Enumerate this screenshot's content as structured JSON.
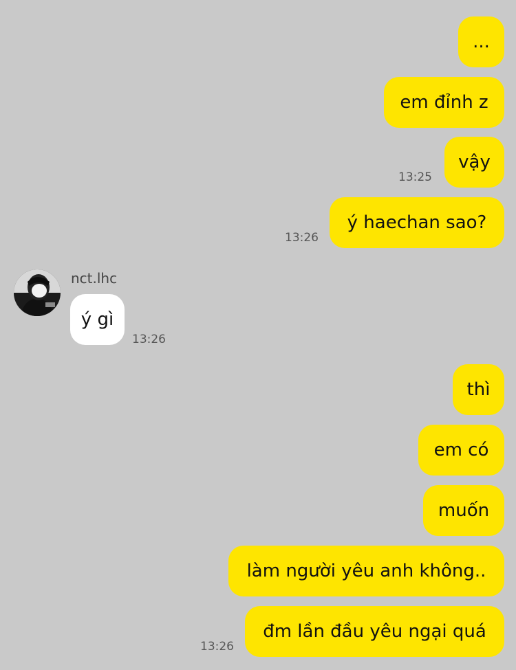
{
  "contact": {
    "name": "nct.lhc"
  },
  "messages": [
    {
      "direction": "outgoing",
      "text": "...",
      "time": ""
    },
    {
      "direction": "outgoing",
      "text": "em đỉnh z",
      "time": ""
    },
    {
      "direction": "outgoing",
      "text": "vậy",
      "time": "13:25"
    },
    {
      "direction": "outgoing",
      "text": "ý haechan sao?",
      "time": "13:26"
    },
    {
      "direction": "incoming",
      "text": "ý gì",
      "time": "13:26"
    },
    {
      "direction": "outgoing",
      "text": "thì",
      "time": ""
    },
    {
      "direction": "outgoing",
      "text": "em có",
      "time": ""
    },
    {
      "direction": "outgoing",
      "text": "muốn",
      "time": ""
    },
    {
      "direction": "outgoing",
      "text": "làm người yêu anh không..",
      "time": ""
    },
    {
      "direction": "outgoing",
      "text": "đm lần đầu yêu ngại quá",
      "time": "13:26"
    }
  ],
  "colors": {
    "background": "#c9c9c9",
    "outgoing_bubble": "#fee500",
    "incoming_bubble": "#ffffff"
  }
}
